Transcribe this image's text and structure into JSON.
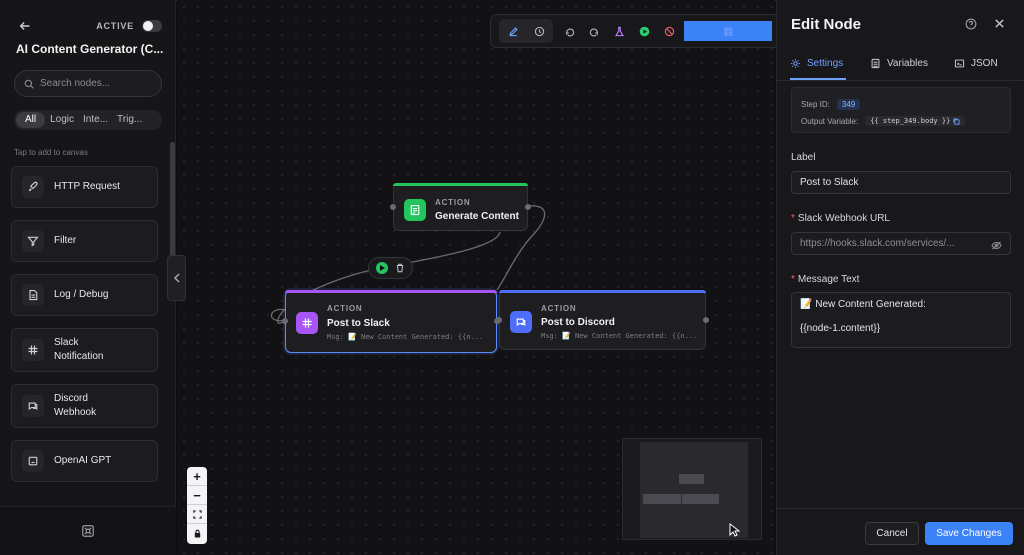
{
  "sidebar": {
    "active_label": "ACTIVE",
    "workflow_title": "AI Content Generator (C...",
    "search_placeholder": "Search nodes...",
    "filters": [
      "All",
      "Logic",
      "Inte...",
      "Trig..."
    ],
    "hint": "Tap to add to canvas",
    "items": [
      {
        "label": "HTTP Request",
        "icon": "rocket-icon"
      },
      {
        "label": "Filter",
        "icon": "funnel-icon"
      },
      {
        "label": "Log / Debug",
        "icon": "document-icon"
      },
      {
        "label": "Slack\nNotification",
        "icon": "slack-icon"
      },
      {
        "label": "Discord\nWebhook",
        "icon": "chat-icon"
      },
      {
        "label": "OpenAI GPT",
        "icon": "cpu-icon"
      }
    ]
  },
  "canvas": {
    "nodes": {
      "generate": {
        "type": "ACTION",
        "name": "Generate Content"
      },
      "slack": {
        "type": "ACTION",
        "name": "Post to Slack",
        "msg": "Msg: 📝 New Content Generated: {{n..."
      },
      "discord": {
        "type": "ACTION",
        "name": "Post to Discord",
        "msg": "Msg: 📝 New Content Generated: {{n..."
      }
    },
    "zoom": {
      "in": "+",
      "out": "−"
    }
  },
  "panel": {
    "title": "Edit Node",
    "tabs": [
      "Settings",
      "Variables",
      "JSON"
    ],
    "step_id_label": "Step ID:",
    "step_id": "349",
    "output_var_label": "Output Variable:",
    "output_var": "{{ step_349.body }}",
    "label_field": {
      "label": "Label",
      "value": "Post to Slack"
    },
    "webhook_field": {
      "label": "Slack Webhook URL",
      "placeholder": "https://hooks.slack.com/services/..."
    },
    "message_field": {
      "label": "Message Text",
      "line1": "📝 New Content Generated:",
      "line2": "{{node-1.content}}"
    },
    "cancel": "Cancel",
    "save": "Save Changes"
  },
  "colors": {
    "accent": "#3b82f6",
    "generate": "#22c55e",
    "slack": "#a855f7",
    "discord": "#4f6ef7",
    "required": "#ff5c6c"
  }
}
